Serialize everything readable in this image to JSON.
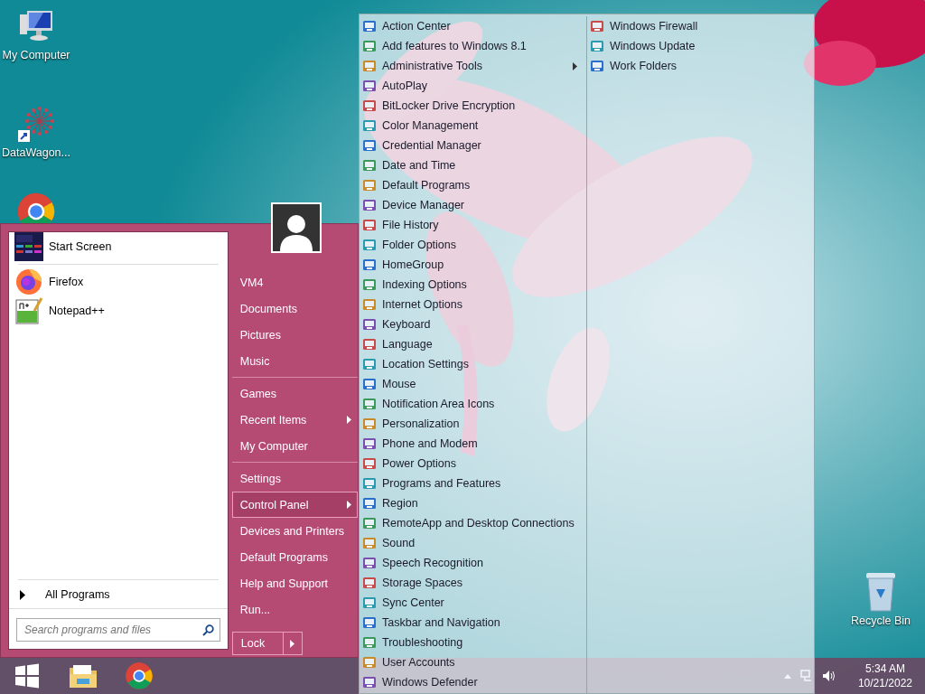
{
  "desktop_icons": [
    {
      "label": "My Computer",
      "kind": "computer"
    },
    {
      "label": "DataWagon...",
      "kind": "shortcut"
    },
    {
      "kind": "chrome"
    }
  ],
  "recycle_bin": {
    "label": "Recycle Bin"
  },
  "start_menu": {
    "pinned": [
      {
        "label": "Start Screen",
        "kind": "start"
      },
      {
        "label": "Firefox",
        "kind": "firefox"
      },
      {
        "label": "Notepad++",
        "kind": "notepad"
      }
    ],
    "all_programs": "All Programs",
    "search": {
      "placeholder": "Search programs and files"
    },
    "groups": [
      [
        {
          "label": "VM4",
          "selected": false,
          "has_submenu": false
        },
        {
          "label": "Documents",
          "selected": false,
          "has_submenu": false
        },
        {
          "label": "Pictures",
          "selected": false,
          "has_submenu": false
        },
        {
          "label": "Music",
          "selected": false,
          "has_submenu": false
        }
      ],
      [
        {
          "label": "Games",
          "selected": false,
          "has_submenu": false
        },
        {
          "label": "Recent Items",
          "selected": false,
          "has_submenu": true
        },
        {
          "label": "My Computer",
          "selected": false,
          "has_submenu": false
        }
      ],
      [
        {
          "label": "Settings",
          "selected": false,
          "has_submenu": false
        },
        {
          "label": "Control Panel",
          "selected": true,
          "has_submenu": true
        },
        {
          "label": "Devices and Printers",
          "selected": false,
          "has_submenu": false
        },
        {
          "label": "Default Programs",
          "selected": false,
          "has_submenu": false
        },
        {
          "label": "Help and Support",
          "selected": false,
          "has_submenu": false
        },
        {
          "label": "Run...",
          "selected": false,
          "has_submenu": false
        }
      ]
    ],
    "lock": "Lock"
  },
  "control_panel": {
    "columns": [
      [
        {
          "label": "Action Center",
          "has_submenu": false
        },
        {
          "label": "Add features to Windows 8.1",
          "has_submenu": false
        },
        {
          "label": "Administrative Tools",
          "has_submenu": true
        },
        {
          "label": "AutoPlay",
          "has_submenu": false
        },
        {
          "label": "BitLocker Drive Encryption",
          "has_submenu": false
        },
        {
          "label": "Color Management",
          "has_submenu": false
        },
        {
          "label": "Credential Manager",
          "has_submenu": false
        },
        {
          "label": "Date and Time",
          "has_submenu": false
        },
        {
          "label": "Default Programs",
          "has_submenu": false
        },
        {
          "label": "Device Manager",
          "has_submenu": false
        },
        {
          "label": "File History",
          "has_submenu": false
        },
        {
          "label": "Folder Options",
          "has_submenu": false
        },
        {
          "label": "HomeGroup",
          "has_submenu": false
        },
        {
          "label": "Indexing Options",
          "has_submenu": false
        },
        {
          "label": "Internet Options",
          "has_submenu": false
        },
        {
          "label": "Keyboard",
          "has_submenu": false
        },
        {
          "label": "Language",
          "has_submenu": false
        },
        {
          "label": "Location Settings",
          "has_submenu": false
        },
        {
          "label": "Mouse",
          "has_submenu": false
        },
        {
          "label": "Notification Area Icons",
          "has_submenu": false
        },
        {
          "label": "Personalization",
          "has_submenu": false
        },
        {
          "label": "Phone and Modem",
          "has_submenu": false
        },
        {
          "label": "Power Options",
          "has_submenu": false
        },
        {
          "label": "Programs and Features",
          "has_submenu": false
        },
        {
          "label": "Region",
          "has_submenu": false
        },
        {
          "label": "RemoteApp and Desktop Connections",
          "has_submenu": false
        },
        {
          "label": "Sound",
          "has_submenu": false
        },
        {
          "label": "Speech Recognition",
          "has_submenu": false
        },
        {
          "label": "Storage Spaces",
          "has_submenu": false
        },
        {
          "label": "Sync Center",
          "has_submenu": false
        },
        {
          "label": "Taskbar and Navigation",
          "has_submenu": false
        },
        {
          "label": "Troubleshooting",
          "has_submenu": false
        },
        {
          "label": "User Accounts",
          "has_submenu": false
        },
        {
          "label": "Windows Defender",
          "has_submenu": false
        }
      ],
      [
        {
          "label": "Windows Firewall",
          "has_submenu": false
        },
        {
          "label": "Windows Update",
          "has_submenu": false
        },
        {
          "label": "Work Folders",
          "has_submenu": false
        }
      ]
    ]
  },
  "taskbar": {
    "apps": [
      {
        "kind": "start"
      },
      {
        "kind": "explorer"
      },
      {
        "kind": "chrome"
      }
    ],
    "clock": {
      "time": "5:34 AM",
      "date": "10/21/2022"
    }
  }
}
